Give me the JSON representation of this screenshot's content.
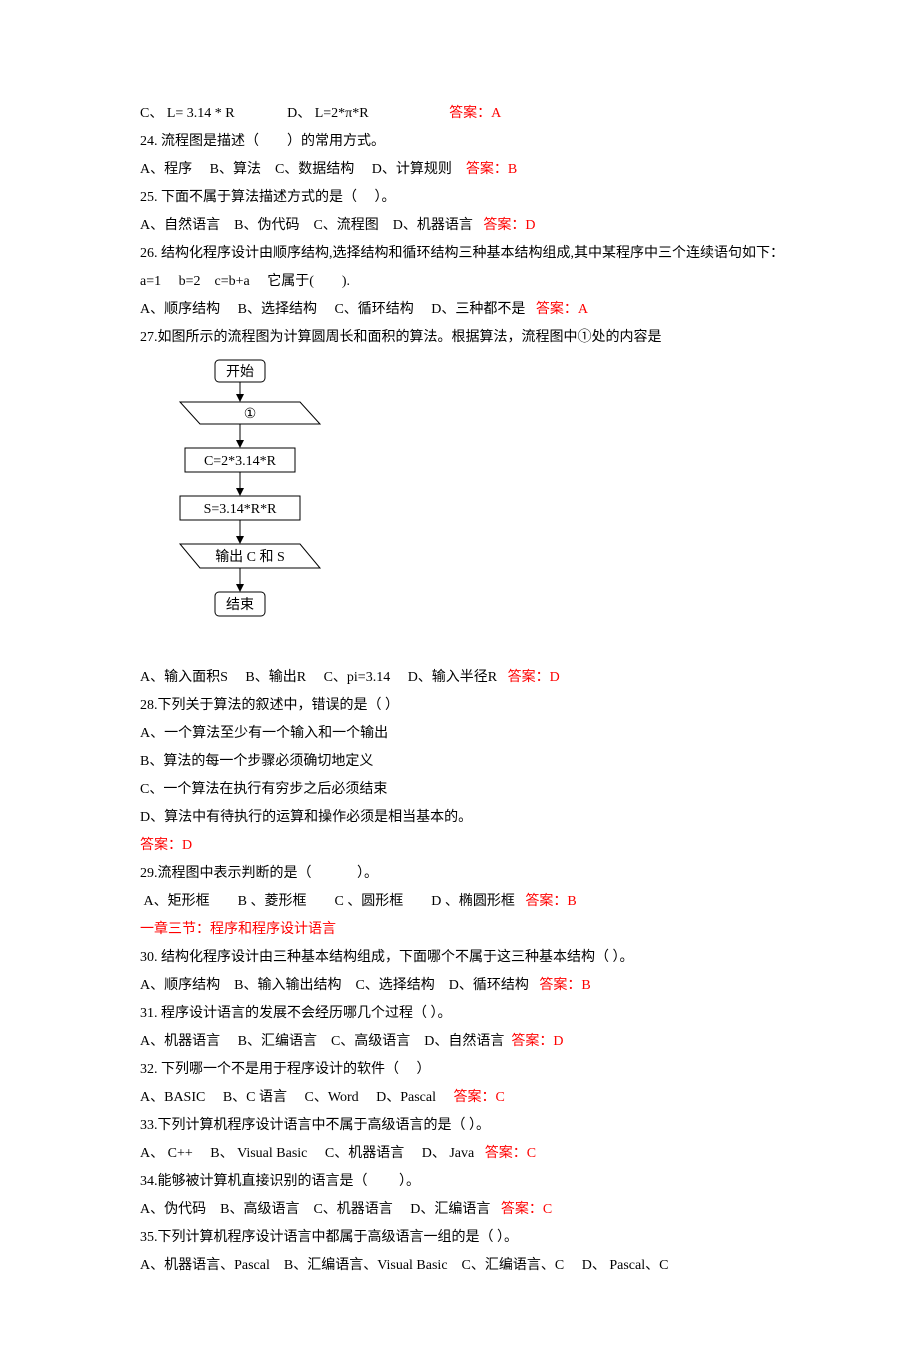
{
  "q23": {
    "optC": "C、 L= 3.14 * R",
    "optD": "D、 L=2*π*R",
    "answer": "答案：A"
  },
  "q24": {
    "stem": "24. 流程图是描述（　　）的常用方式。",
    "opts": "A、程序　 B、算法　C、数据结构　 D、计算规则",
    "answer": "答案：B"
  },
  "q25": {
    "stem": "25. 下面不属于算法描述方式的是（　 ）。",
    "opts": "A、自然语言　B、伪代码　C、流程图　D、机器语言",
    "answer": "答案：D"
  },
  "q26": {
    "stem1": "26. 结构化程序设计由顺序结构,选择结构和循环结构三种基本结构组成,其中某程序中三个连续语句如下：",
    "stem2": "a=1　 b=2　c=b+a　 它属于(　　).",
    "opts": "A、顺序结构　 B、选择结构　 C、循环结构　 D、三种都不是",
    "answer": "答案：A"
  },
  "q27": {
    "stem": "27.如图所示的流程图为计算圆周长和面积的算法。根据算法，流程图中①处的内容是",
    "opts": "A、输入面积S　 B、输出R　 C、pi=3.14　 D、输入半径R",
    "answer": "答案：D",
    "flow": {
      "start": "开始",
      "box1": "①",
      "box2": "C=2*3.14*R",
      "box3": "S=3.14*R*R",
      "box4": "输出 C 和 S",
      "end": "结束"
    }
  },
  "q28": {
    "stem": "28.下列关于算法的叙述中，错误的是（ ）",
    "a": "A、一个算法至少有一个输入和一个输出",
    "b": "B、算法的每一个步骤必须确切地定义",
    "c": "C、一个算法在执行有穷步之后必须结束",
    "d": "D、算法中有待执行的运算和操作必须是相当基本的。",
    "answer": "答案：D"
  },
  "q29": {
    "stem": "29.流程图中表示判断的是（　　　 ）。",
    "opts": " A、矩形框　　B 、菱形框　　C 、圆形框　　D 、椭圆形框",
    "answer": "答案：B"
  },
  "section": "一章三节：程序和程序设计语言",
  "q30": {
    "stem": "30. 结构化程序设计由三种基本结构组成，下面哪个不属于这三种基本结构（ ）。",
    "opts": "A、顺序结构　B、输入输出结构　C、选择结构　D、循环结构",
    "answer": "答案：B"
  },
  "q31": {
    "stem": "31. 程序设计语言的发展不会经历哪几个过程（ ）。",
    "opts": "A、机器语言　 B、汇编语言　C、高级语言　D、自然语言",
    "answer": "答案：D"
  },
  "q32": {
    "stem": "32. 下列哪一个不是用于程序设计的软件（　 ）",
    "opts": "A、BASIC　 B、C 语言　 C、Word　 D、Pascal",
    "answer": "答案：C"
  },
  "q33": {
    "stem": "33.下列计算机程序设计语言中不属于高级语言的是（ ）。",
    "opts": "A、 C++　 B、 Visual Basic　 C、机器语言　 D、 Java",
    "answer": "答案：C"
  },
  "q34": {
    "stem": "34.能够被计算机直接识别的语言是（　　 ）。",
    "opts": "A、伪代码　B、高级语言　C、机器语言　 D、汇编语言",
    "answer": "答案：C"
  },
  "q35": {
    "stem": "35.下列计算机程序设计语言中都属于高级语言一组的是（ ）。",
    "opts": "A、机器语言、Pascal　B、汇编语言、Visual Basic　C、汇编语言、C　 D、 Pascal、C"
  }
}
